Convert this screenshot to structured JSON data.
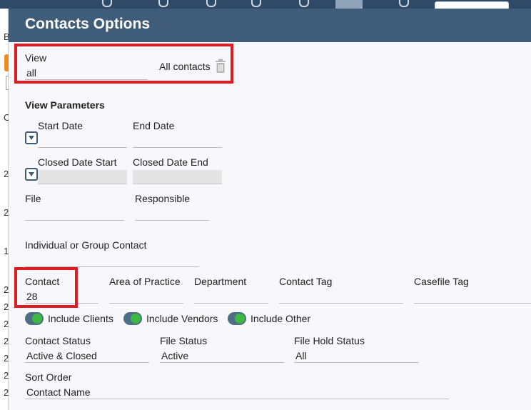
{
  "dialog": {
    "title": "Contacts Options",
    "view": {
      "label": "View",
      "value": "all"
    },
    "view_summary": "All contacts",
    "view_parameters_title": "View Parameters",
    "start_date": {
      "label": "Start Date",
      "value": ""
    },
    "end_date": {
      "label": "End Date",
      "value": ""
    },
    "closed_date_start": {
      "label": "Closed Date Start",
      "value": ""
    },
    "closed_date_end": {
      "label": "Closed Date End",
      "value": ""
    },
    "file": {
      "label": "File",
      "value": ""
    },
    "responsible": {
      "label": "Responsible",
      "value": ""
    },
    "individual_group": {
      "label": "Individual or Group Contact",
      "value": ""
    },
    "contact": {
      "label": "Contact",
      "value": "28"
    },
    "area_of_practice": {
      "label": "Area of Practice",
      "value": ""
    },
    "department": {
      "label": "Department",
      "value": ""
    },
    "contact_tag": {
      "label": "Contact Tag",
      "value": ""
    },
    "casefile_tag": {
      "label": "Casefile Tag",
      "value": ""
    },
    "toggles": [
      {
        "label": "Include Clients",
        "on": true
      },
      {
        "label": "Include Vendors",
        "on": true
      },
      {
        "label": "Include Other",
        "on": true
      }
    ],
    "contact_status": {
      "label": "Contact Status",
      "value": "Active & Closed"
    },
    "file_status": {
      "label": "File Status",
      "value": "Active"
    },
    "file_hold_status": {
      "label": "File Hold Status",
      "value": "All"
    },
    "sort_order": {
      "label": "Sort Order",
      "value": "Contact Name"
    }
  },
  "background": {
    "left_letters": [
      "B",
      "C",
      "2",
      "2",
      "1",
      "2",
      "2",
      "2",
      "2",
      "2",
      "2",
      "2"
    ]
  },
  "colors": {
    "header": "#3f5c78",
    "highlight": "#e01b24",
    "toggle_on": "#3db843"
  }
}
